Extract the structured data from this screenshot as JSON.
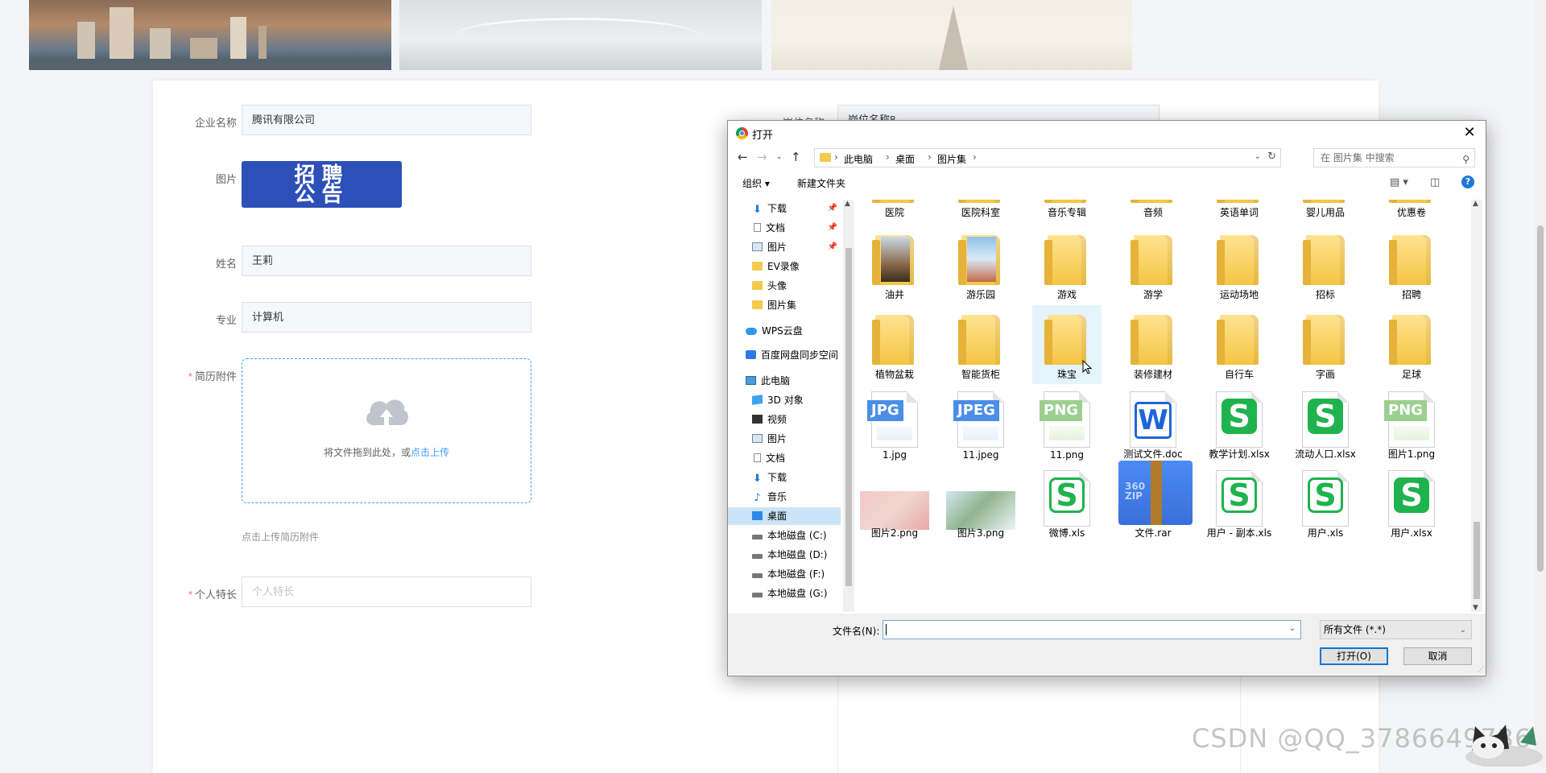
{
  "form": {
    "company_label": "企业名称",
    "company_value": "腾讯有限公司",
    "position_label": "岗位名称",
    "position_value": "岗位名称8",
    "image_label": "图片",
    "poster_text_line1": "招聘",
    "poster_text_line2": "公告",
    "name_label": "姓名",
    "name_value": "王莉",
    "major_label": "专业",
    "major_value": "计算机",
    "resume_label": "简历附件",
    "upload_text": "将文件拖到此处，或",
    "upload_link": "点击上传",
    "upload_tip": "点击上传简历附件",
    "skill_label": "个人特长",
    "skill_placeholder": "个人特长",
    "required_mark": "*"
  },
  "dialog": {
    "title": "打开",
    "close": "✕",
    "path": [
      "此电脑",
      "桌面",
      "图片集"
    ],
    "search_placeholder": "在 图片集 中搜索",
    "organize": "组织 ▾",
    "new_folder": "新建文件夹",
    "help": "?",
    "nav": [
      {
        "label": "下载",
        "icon": "download-icon",
        "pinned": true
      },
      {
        "label": "文档",
        "icon": "document-icon",
        "pinned": true
      },
      {
        "label": "图片",
        "icon": "picture-icon",
        "pinned": true
      },
      {
        "label": "EV录像",
        "icon": "folder-icon"
      },
      {
        "label": "头像",
        "icon": "folder-icon"
      },
      {
        "label": "图片集",
        "icon": "folder-icon"
      },
      {
        "label": "WPS云盘",
        "icon": "cloud-icon"
      },
      {
        "label": "百度网盘同步空间",
        "icon": "baidu-icon"
      },
      {
        "label": "此电脑",
        "icon": "computer-icon"
      },
      {
        "label": "3D 对象",
        "icon": "cube-icon"
      },
      {
        "label": "视频",
        "icon": "video-icon"
      },
      {
        "label": "图片",
        "icon": "picture-icon"
      },
      {
        "label": "文档",
        "icon": "document-icon"
      },
      {
        "label": "下载",
        "icon": "download-icon"
      },
      {
        "label": "音乐",
        "icon": "music-icon"
      },
      {
        "label": "桌面",
        "icon": "desktop-icon",
        "selected": true
      },
      {
        "label": "本地磁盘 (C:)",
        "icon": "disk-icon"
      },
      {
        "label": "本地磁盘 (D:)",
        "icon": "disk-icon"
      },
      {
        "label": "本地磁盘 (F:)",
        "icon": "disk-icon"
      },
      {
        "label": "本地磁盘 (G:)",
        "icon": "disk-icon"
      }
    ],
    "row1": [
      "医院",
      "医院科室",
      "音乐专辑",
      "音频",
      "英语单词",
      "婴儿用品",
      "优惠卷"
    ],
    "row2": [
      "油井",
      "游乐园",
      "游戏",
      "游学",
      "运动场地",
      "招标",
      "招聘"
    ],
    "row3": [
      "植物盆栽",
      "智能货柜",
      "珠宝",
      "装修建材",
      "自行车",
      "字画",
      "足球"
    ],
    "row4": [
      {
        "name": "1.jpg",
        "kind": "JPG"
      },
      {
        "name": "11.jpeg",
        "kind": "JPEG"
      },
      {
        "name": "11.png",
        "kind": "PNG"
      },
      {
        "name": "测试文件.doc",
        "kind": "W"
      },
      {
        "name": "教学计划.xlsx",
        "kind": "S"
      },
      {
        "name": "流动人口.xlsx",
        "kind": "S"
      },
      {
        "name": "图片1.png",
        "kind": "PNG"
      }
    ],
    "row5": [
      {
        "name": "图片2.png"
      },
      {
        "name": "图片3.png"
      },
      {
        "name": "微博.xls",
        "kind": "S"
      },
      {
        "name": "文件.rar",
        "kind": "360\nZIP"
      },
      {
        "name": "用户 - 副本.xls",
        "kind": "S"
      },
      {
        "name": "用户.xls",
        "kind": "S"
      },
      {
        "name": "用户.xlsx",
        "kind": "S"
      }
    ],
    "filename_label": "文件名(N):",
    "filename_value": "",
    "filetype": "所有文件 (*.*)",
    "open_button": "打开(O)",
    "cancel_button": "取消"
  },
  "watermark": "CSDN @QQ_3786649736"
}
